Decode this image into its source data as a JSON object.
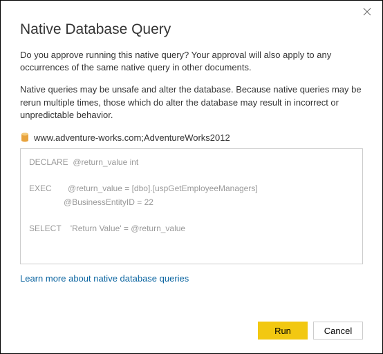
{
  "dialog": {
    "title": "Native Database Query",
    "paragraph1": "Do you approve running this native query? Your approval will also apply to any occurrences of the same native query in other documents.",
    "paragraph2": "Native queries may be unsafe and alter the database. Because native queries may be rerun multiple times, those which do alter the database may result in incorrect or unpredictable behavior.",
    "connection": "www.adventure-works.com;AdventureWorks2012",
    "query_text": "DECLARE  @return_value int\n\nEXEC       @return_value = [dbo].[uspGetEmployeeManagers]\n               @BusinessEntityID = 22\n\nSELECT    'Return Value' = @return_value",
    "learn_more": "Learn more about native database queries",
    "run_label": "Run",
    "cancel_label": "Cancel",
    "icon_color": "#e8a33d"
  }
}
